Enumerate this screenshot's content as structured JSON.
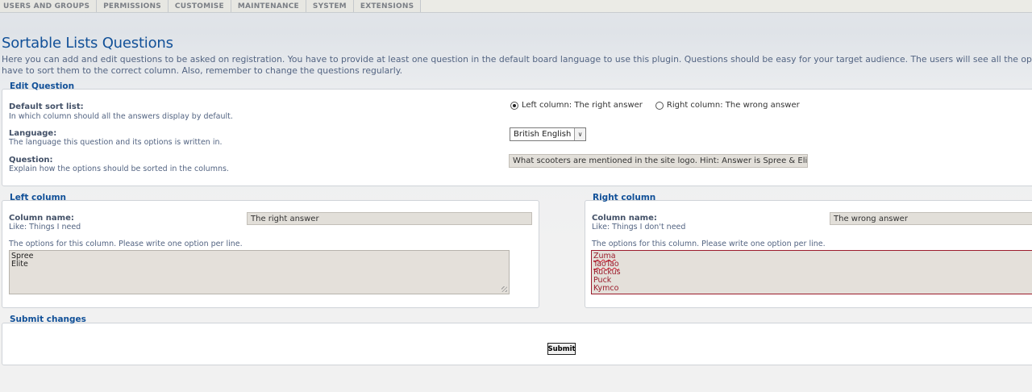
{
  "tabs": [
    "USERS AND GROUPS",
    "PERMISSIONS",
    "CUSTOMISE",
    "MAINTENANCE",
    "SYSTEM",
    "EXTENSIONS"
  ],
  "page": {
    "title": "Sortable Lists Questions",
    "intro_line1": "Here you can add and edit questions to be asked on registration. You have to provide at least one question in the default board language to use this plugin. Questions should be easy for your target audience. The users will see all the options",
    "intro_line2": "have to sort them to the correct column. Also, remember to change the questions regularly."
  },
  "edit_question": {
    "legend": "Edit Question",
    "sort": {
      "title": "Default sort list:",
      "desc": "In which column should all the answers display by default.",
      "options": [
        "Left column: The right answer",
        "Right column: The wrong answer"
      ],
      "selected": "Left column: The right answer"
    },
    "language": {
      "title": "Language:",
      "desc": "The language this question and its options is written in.",
      "value": "British English"
    },
    "question": {
      "title": "Question:",
      "desc": "Explain how the options should be sorted in the columns.",
      "value": "What scooters are mentioned in the site logo. Hint: Answer is Spree & Elite"
    }
  },
  "left_column": {
    "legend": "Left column",
    "name_title": "Column name:",
    "name_desc": "Like: Things I need",
    "name_value": "The right answer",
    "options_label": "The options for this column. Please write one option per line.",
    "options": [
      "Spree",
      "Elite"
    ]
  },
  "right_column": {
    "legend": "Right column",
    "name_title": "Column name:",
    "name_desc": "Like: Things I don't need",
    "name_value": "The wrong answer",
    "options_label": "The options for this column. Please write one option per line.",
    "options": [
      "Zuma",
      "TaoTao",
      "Ruckus",
      "Puck",
      "Kymco"
    ]
  },
  "submit": {
    "legend": "Submit changes",
    "button_label": "Submit"
  }
}
